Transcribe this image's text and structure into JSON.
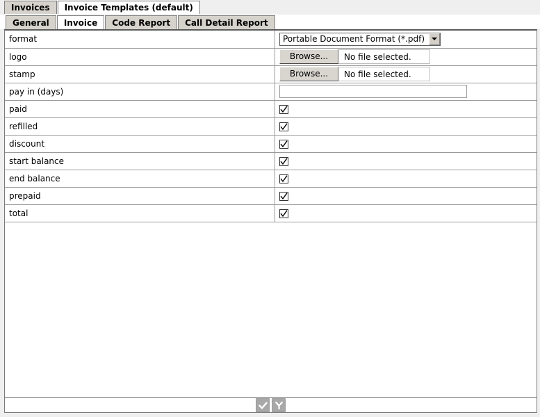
{
  "window": {
    "outer_tabs": [
      {
        "label": "Invoices",
        "active": false
      },
      {
        "label": "Invoice Templates (default)",
        "active": true
      }
    ],
    "inner_tabs": [
      {
        "label": "General",
        "active": false
      },
      {
        "label": "Invoice",
        "active": true
      },
      {
        "label": "Code Report",
        "active": false
      },
      {
        "label": "Call Detail Report",
        "active": false
      }
    ]
  },
  "form": {
    "rows": [
      {
        "label": "format",
        "type": "select",
        "value": "Portable Document Format (*.pdf)"
      },
      {
        "label": "logo",
        "type": "file",
        "button": "Browse...",
        "status": "No file selected."
      },
      {
        "label": "stamp",
        "type": "file",
        "button": "Browse...",
        "status": "No file selected."
      },
      {
        "label": "pay in (days)",
        "type": "text",
        "value": "",
        "placeholder": ""
      },
      {
        "label": "paid",
        "type": "checkbox",
        "checked": true
      },
      {
        "label": "refilled",
        "type": "checkbox",
        "checked": true
      },
      {
        "label": "discount",
        "type": "checkbox",
        "checked": true
      },
      {
        "label": "start balance",
        "type": "checkbox",
        "checked": true
      },
      {
        "label": "end balance",
        "type": "checkbox",
        "checked": true
      },
      {
        "label": "prepaid",
        "type": "checkbox",
        "checked": true
      },
      {
        "label": "total",
        "type": "checkbox",
        "checked": true
      }
    ]
  },
  "toolbar": {
    "buttons": [
      {
        "icon": "check-icon",
        "name": "apply-button"
      },
      {
        "icon": "revert-icon",
        "name": "revert-button"
      }
    ]
  },
  "colors": {
    "tab_inactive": "#d6d3cc",
    "tab_active": "#ffffff",
    "window_bg": "#efefef",
    "border": "#808080",
    "toolbar_button": "#a8a8a8"
  }
}
